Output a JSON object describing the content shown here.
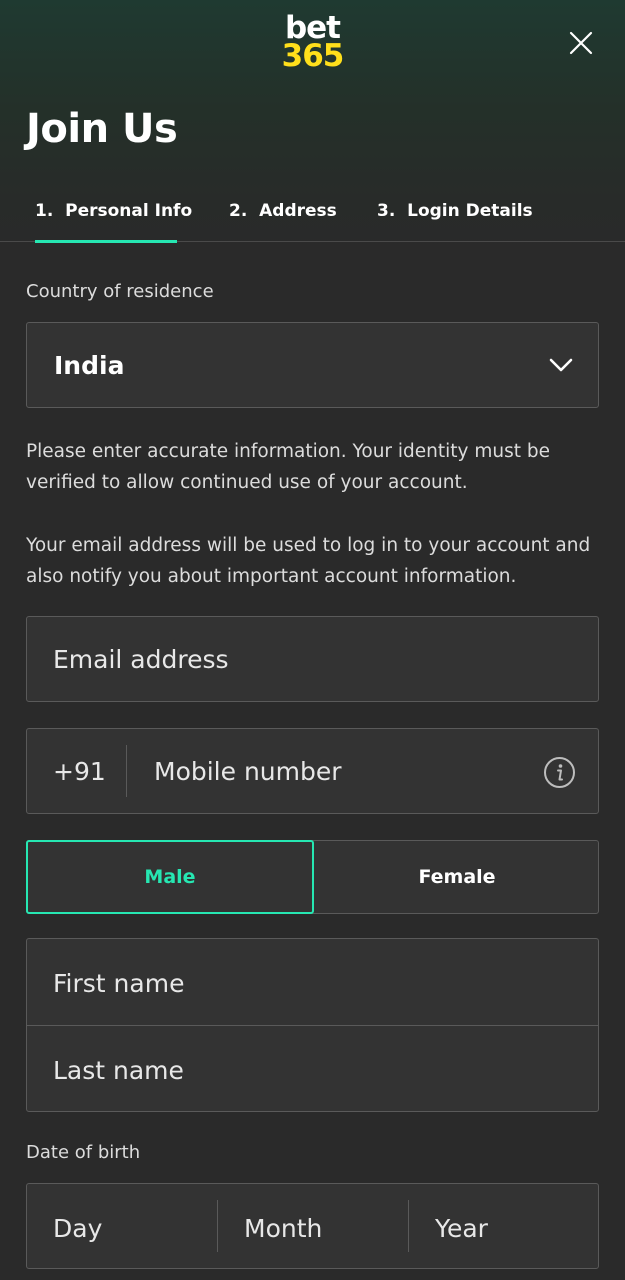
{
  "header": {
    "logo_line1": "bet",
    "logo_line2": "365",
    "title": "Join Us"
  },
  "tabs": [
    {
      "label": "1.  Personal Info",
      "active": true
    },
    {
      "label": "2.  Address",
      "active": false
    },
    {
      "label": "3.  Login Details",
      "active": false
    }
  ],
  "country": {
    "label": "Country of residence",
    "value": "India"
  },
  "notes": {
    "identity": "Please enter accurate information. Your identity must be verified to allow continued use of your account.",
    "email": "Your email address will be used to log in to your account and also notify you about important account information."
  },
  "email": {
    "placeholder": "Email address"
  },
  "mobile": {
    "prefix": "+91",
    "placeholder": "Mobile number"
  },
  "gender": {
    "male": "Male",
    "female": "Female",
    "selected": "Male"
  },
  "name": {
    "first_placeholder": "First name",
    "last_placeholder": "Last name"
  },
  "dob": {
    "label": "Date of birth",
    "day": "Day",
    "month": "Month",
    "year": "Year"
  },
  "colors": {
    "accent": "#26e7b2",
    "logo_yellow": "#ffdf1b",
    "background": "#2a2a2a",
    "field_bg": "#333333"
  },
  "icons": {
    "close": "close-icon",
    "dropdown": "chevron-down-icon",
    "info": "info-icon"
  }
}
